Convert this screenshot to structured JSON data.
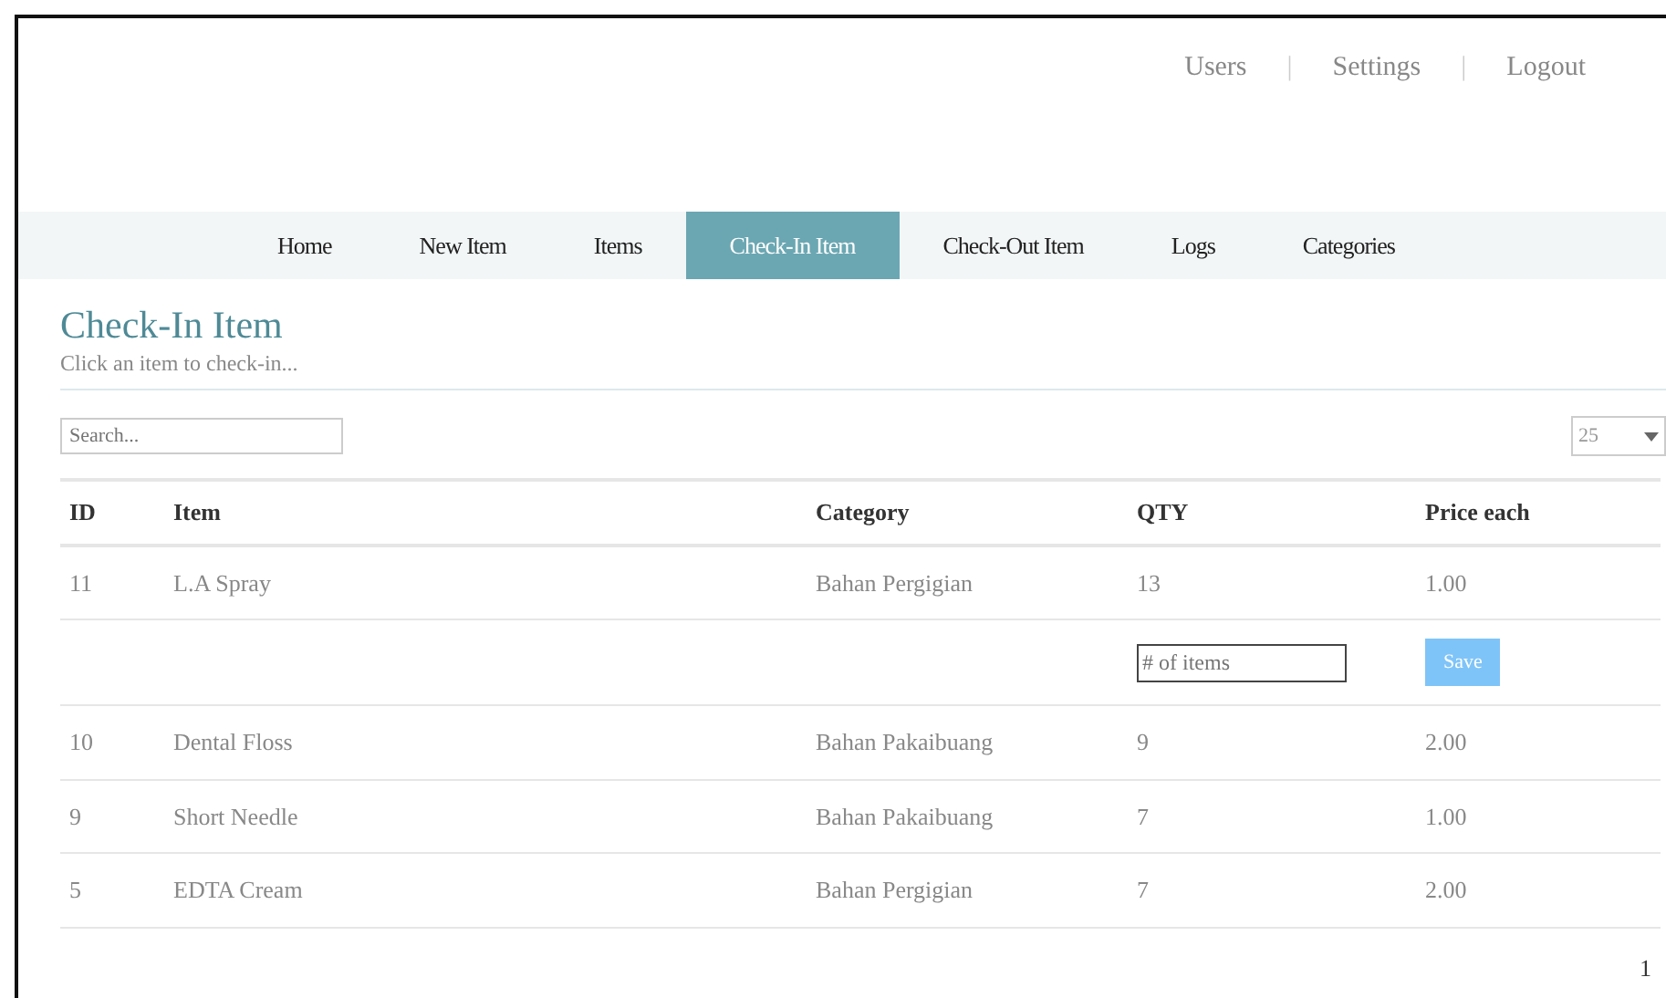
{
  "top_links": [
    "Users",
    "Settings",
    "Logout"
  ],
  "separator": "|",
  "nav": [
    {
      "label": "Home",
      "selected": false
    },
    {
      "label": "New Item",
      "selected": false
    },
    {
      "label": "Items",
      "selected": false
    },
    {
      "label": "Check-In Item",
      "selected": true
    },
    {
      "label": "Check-Out Item",
      "selected": false
    },
    {
      "label": "Logs",
      "selected": false
    },
    {
      "label": "Categories",
      "selected": false
    }
  ],
  "page": {
    "title": "Check-In Item",
    "subtitle": "Click an item to check-in..."
  },
  "search": {
    "placeholder": "Search..."
  },
  "page_size": "25",
  "table": {
    "columns": [
      "ID",
      "Item",
      "Category",
      "QTY",
      "Price each"
    ],
    "rows": [
      {
        "kind": "item",
        "cells": [
          "11",
          "L.A Spray",
          "Bahan Pergigian",
          "13",
          "1.00"
        ]
      },
      {
        "kind": "entry",
        "placeholder": "# of items",
        "button": "Save"
      },
      {
        "kind": "item",
        "cells": [
          "10",
          "Dental Floss",
          "Bahan Pakaibuang",
          "9",
          "2.00"
        ]
      },
      {
        "kind": "item",
        "cells": [
          "9",
          "Short Needle",
          "Bahan Pakaibuang",
          "7",
          "1.00"
        ]
      },
      {
        "kind": "item",
        "cells": [
          "5",
          "EDTA Cream",
          "Bahan Pergigian",
          "7",
          "2.00"
        ]
      }
    ]
  },
  "pagination": [
    "1"
  ]
}
